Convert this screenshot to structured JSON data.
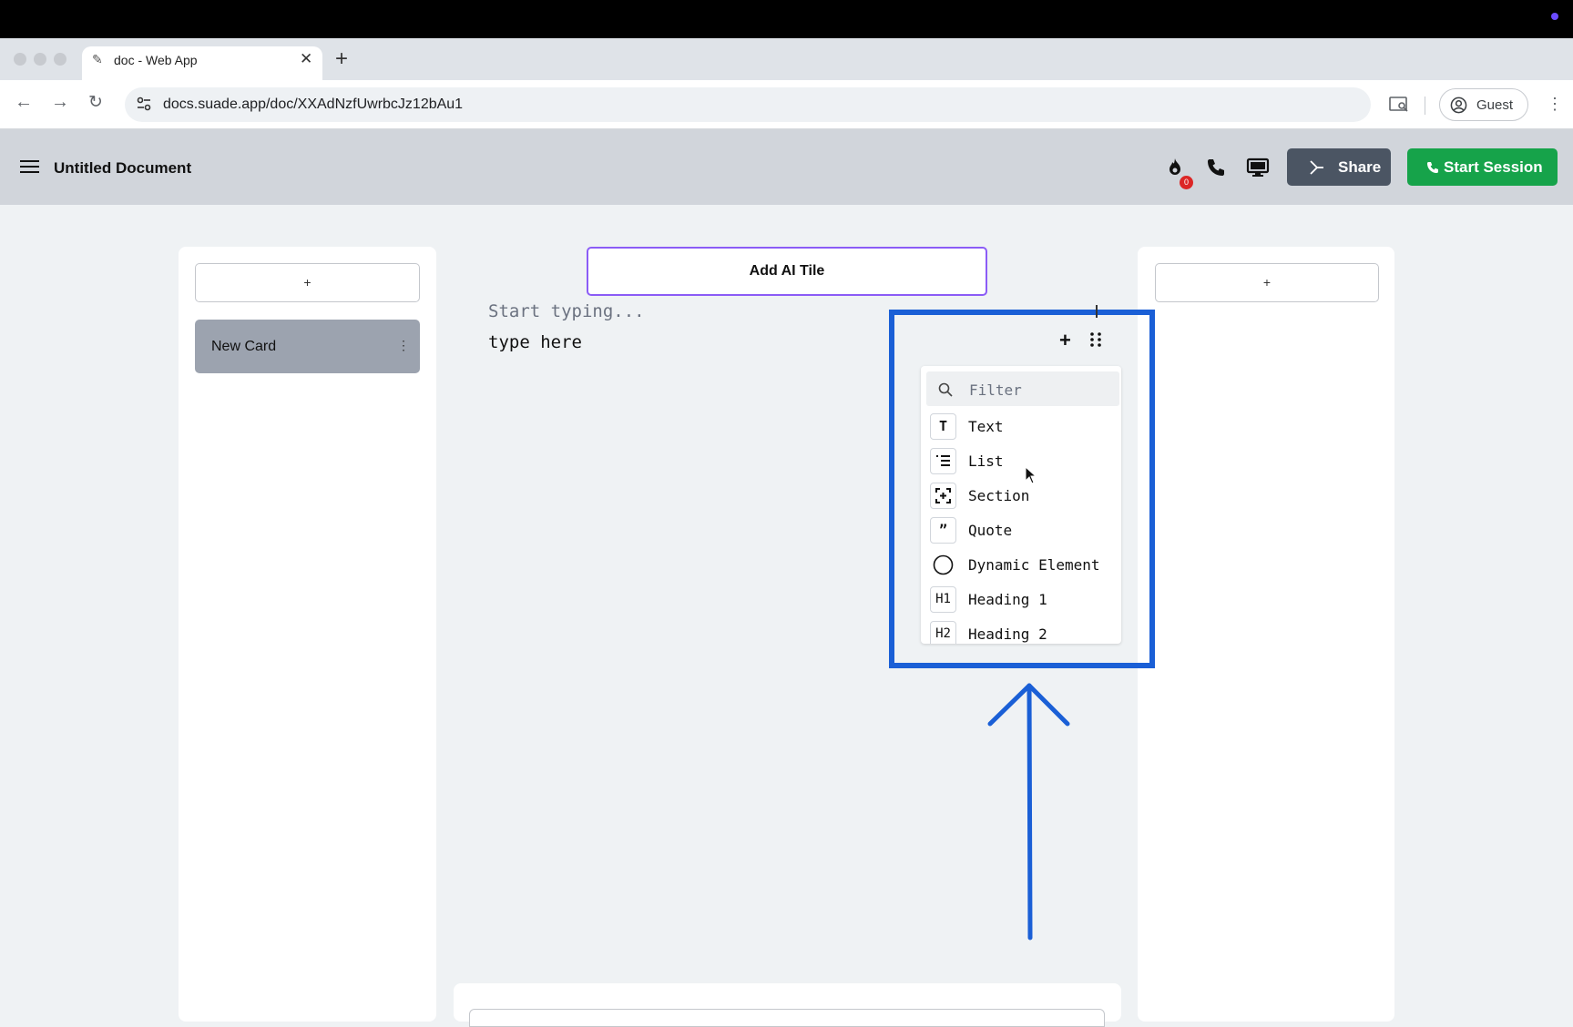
{
  "browser": {
    "tab_title": "doc - Web App",
    "url": "docs.suade.app/doc/XXAdNzfUwrbcJz12bAu1",
    "profile_label": "Guest"
  },
  "app": {
    "doc_title": "Untitled Document",
    "notification_count": "0",
    "share_label": "Share",
    "start_session_label": "Start Session"
  },
  "left_panel": {
    "add_label": "+",
    "card_label": "New Card",
    "card_menu": "⋮"
  },
  "right_panel": {
    "add_label": "+"
  },
  "editor": {
    "ai_tile_label": "Add AI Tile",
    "placeholder": "Start typing...",
    "text": "type here"
  },
  "block_menu": {
    "filter_placeholder": "Filter",
    "items": [
      {
        "icon": "T",
        "label": "Text",
        "icon_name": "text-icon"
      },
      {
        "icon": "list",
        "label": "List",
        "icon_name": "list-icon"
      },
      {
        "icon": "section",
        "label": "Section",
        "icon_name": "section-icon"
      },
      {
        "icon": "”",
        "label": "Quote",
        "icon_name": "quote-icon"
      },
      {
        "icon": "circle",
        "label": "Dynamic Element",
        "icon_name": "circle-icon"
      },
      {
        "icon": "H1",
        "label": "Heading 1",
        "icon_name": "heading-1-icon"
      },
      {
        "icon": "H2",
        "label": "Heading 2",
        "icon_name": "heading-2-icon"
      }
    ]
  },
  "colors": {
    "highlight": "#1a5fd6",
    "ai_tile_border": "#8b5cf6",
    "share_bg": "#4b5563",
    "session_bg": "#16a34a",
    "badge": "#dc2626"
  }
}
